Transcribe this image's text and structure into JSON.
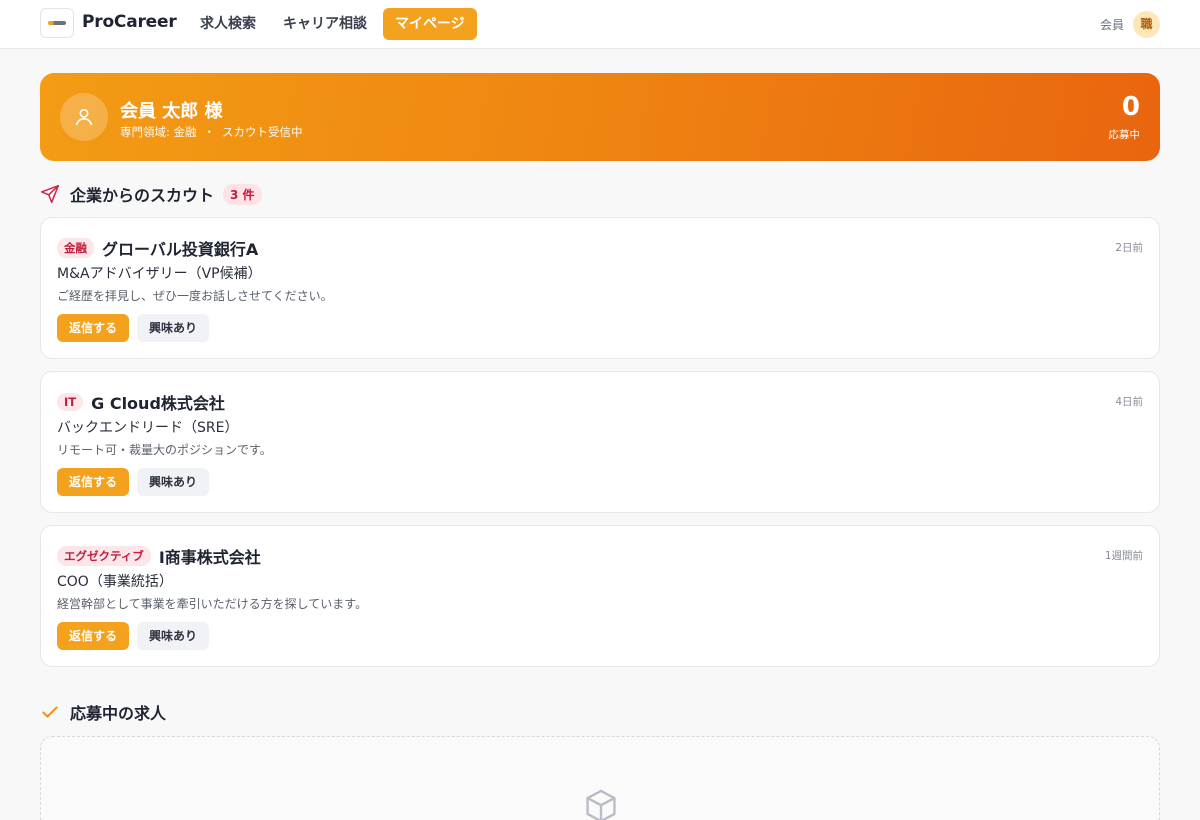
{
  "header": {
    "brand": "ProCareer",
    "nav": [
      {
        "label": "求人検索"
      },
      {
        "label": "キャリア相談"
      },
      {
        "label": "マイページ",
        "active": true
      }
    ],
    "member_label": "会員",
    "avatar_text": "職"
  },
  "hero": {
    "name": "会員 太郎 様",
    "field": "専門領域: 金融",
    "separator": "・",
    "status": "スカウト受信中",
    "count": "0",
    "count_label": "応募中"
  },
  "scouts": {
    "title": "企業からのスカウト",
    "count_badge": "3 件",
    "items": [
      {
        "tag": "金融",
        "company": "グローバル投資銀行A",
        "time": "2日前",
        "position": "M&Aアドバイザリー（VP候補）",
        "message": "ご経歴を拝見し、ぜひ一度お話しさせてください。",
        "reply_label": "返信する",
        "interest_label": "興味あり"
      },
      {
        "tag": "IT",
        "company": "G Cloud株式会社",
        "time": "4日前",
        "position": "バックエンドリード（SRE）",
        "message": "リモート可・裁量大のポジションです。",
        "reply_label": "返信する",
        "interest_label": "興味あり"
      },
      {
        "tag": "エグゼクティブ",
        "company": "I商事株式会社",
        "time": "1週間前",
        "position": "COO（事業統括）",
        "message": "経営幹部として事業を牽引いただける方を探しています。",
        "reply_label": "返信する",
        "interest_label": "興味あり"
      }
    ]
  },
  "applications": {
    "title": "応募中の求人"
  },
  "colors": {
    "accent": "#f4a21e",
    "hero_start": "#f39c14",
    "hero_end": "#e9650f",
    "tag_bg": "#fde6ea",
    "tag_text": "#c21d3c"
  },
  "icons": {
    "scouts": "paper-plane-icon",
    "applications": "check-icon",
    "empty": "box-icon",
    "hero_avatar": "user-icon"
  }
}
